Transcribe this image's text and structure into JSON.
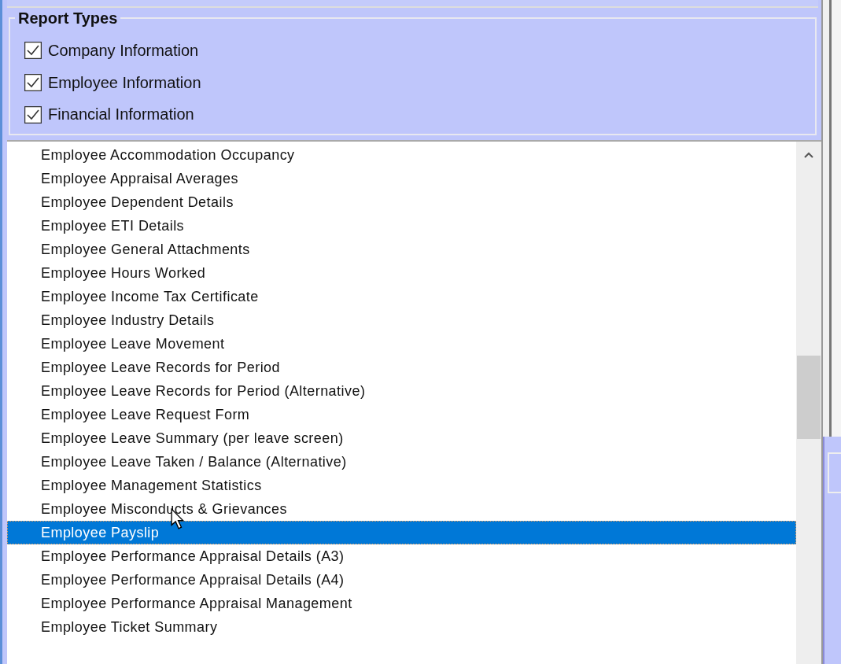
{
  "report_types": {
    "title": "Report Types",
    "options": [
      {
        "label": "Company Information",
        "checked": true
      },
      {
        "label": "Employee Information",
        "checked": true
      },
      {
        "label": "Financial Information",
        "checked": true
      }
    ]
  },
  "reports": [
    {
      "label": "Employee Accommodation Occupancy",
      "selected": false
    },
    {
      "label": "Employee Appraisal Averages",
      "selected": false
    },
    {
      "label": "Employee Dependent Details",
      "selected": false
    },
    {
      "label": "Employee ETI Details",
      "selected": false
    },
    {
      "label": "Employee General Attachments",
      "selected": false
    },
    {
      "label": "Employee Hours Worked",
      "selected": false
    },
    {
      "label": "Employee Income Tax Certificate",
      "selected": false
    },
    {
      "label": "Employee Industry Details",
      "selected": false
    },
    {
      "label": "Employee Leave Movement",
      "selected": false
    },
    {
      "label": "Employee Leave Records for Period",
      "selected": false
    },
    {
      "label": "Employee Leave Records for Period (Alternative)",
      "selected": false
    },
    {
      "label": "Employee Leave Request Form",
      "selected": false
    },
    {
      "label": "Employee Leave Summary (per leave screen)",
      "selected": false
    },
    {
      "label": "Employee Leave Taken / Balance (Alternative)",
      "selected": false
    },
    {
      "label": "Employee Management Statistics",
      "selected": false
    },
    {
      "label": "Employee Misconducts & Grievances",
      "selected": false
    },
    {
      "label": "Employee Payslip",
      "selected": true
    },
    {
      "label": "Employee Performance Appraisal Details (A3)",
      "selected": false
    },
    {
      "label": "Employee Performance Appraisal Details (A4)",
      "selected": false
    },
    {
      "label": "Employee Performance Appraisal Management",
      "selected": false
    },
    {
      "label": "Employee Ticket Summary",
      "selected": false
    }
  ]
}
